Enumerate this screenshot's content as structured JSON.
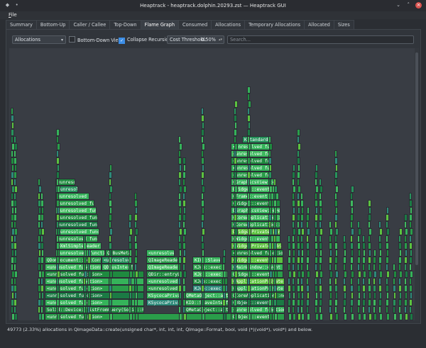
{
  "window": {
    "title": "Heaptrack - heaptrack.dolphin.20293.zst — Heaptrack GUI",
    "left_icons": [
      "app-icon",
      "pin-icon"
    ],
    "controls": [
      "minimize-icon",
      "maximize-icon",
      "close-icon"
    ]
  },
  "menu": {
    "file": "File"
  },
  "tabs": [
    {
      "label": "Summary",
      "active": false
    },
    {
      "label": "Bottom-Up",
      "active": false
    },
    {
      "label": "Caller / Callee",
      "active": false
    },
    {
      "label": "Top-Down",
      "active": false
    },
    {
      "label": "Flame Graph",
      "active": true
    },
    {
      "label": "Consumed",
      "active": false
    },
    {
      "label": "Allocations",
      "active": false
    },
    {
      "label": "Temporary Allocations",
      "active": false
    },
    {
      "label": "Allocated",
      "active": false
    },
    {
      "label": "Sizes",
      "active": false
    }
  ],
  "toolbar": {
    "mode_value": "Allocations",
    "bottom_down_label": "Bottom-Down View",
    "bottom_down_checked": false,
    "collapse_label": "Collapse Recursion",
    "collapse_checked": true,
    "cost_threshold_label": "Cost Threshold:",
    "cost_threshold_value": "0.50%",
    "search_placeholder": "Search..."
  },
  "flame": {
    "labeled_frames": [
      "<unresolved function>",
      "Solid::Device::listFromQuery(Solid::Predicate",
      "QDomDocument::setContent",
      "QDBusInterface",
      "QDBusMetaType",
      "QXmlSimpleReader",
      "QImageReader::read",
      "QDir::entryList",
      "KSycocaPrivate",
      "KServiceType",
      "KIO::SlaveInterface",
      "KJob::exec",
      "QMetaObject::activate",
      "QApplicationPrivate::notify_helper",
      "QCoreApplication::notifyInternal",
      "QObject::event",
      "QMainWindow::event",
      "QWidgetPrivate::drawWidget",
      "QWidget::event",
      "QFrame::event",
      "QGraphicsView::event",
      "KStandardDirs"
    ]
  },
  "status": "49773 (2.33%) allocations in QImageData::create(unsigned char*, int, int, int, QImage::Format, bool, void (*)(void*), void*) and below.",
  "colors": {
    "frame_greens": [
      "#2a9d4a",
      "#1f8a3f",
      "#35b35a",
      "#3fb95f",
      "#1b7a44",
      "#27935c",
      "#5cc23f",
      "#2d8a7a"
    ],
    "background": "#393d44"
  }
}
